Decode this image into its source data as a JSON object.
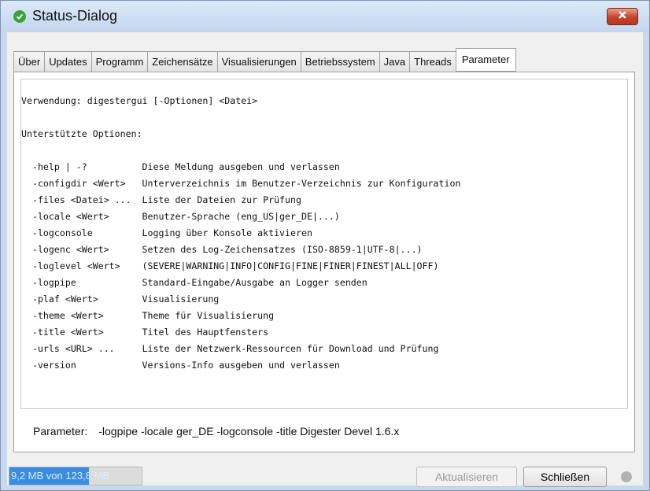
{
  "window": {
    "title": "Status-Dialog"
  },
  "tabs": [
    {
      "label": "Über"
    },
    {
      "label": "Updates"
    },
    {
      "label": "Programm"
    },
    {
      "label": "Zeichensätze"
    },
    {
      "label": "Visualisierungen"
    },
    {
      "label": "Betriebssystem"
    },
    {
      "label": "Java"
    },
    {
      "label": "Threads"
    },
    {
      "label": "Parameter",
      "active": true
    }
  ],
  "content": {
    "lines": [
      "Verwendung: digestergui [-Optionen] <Datei>",
      "",
      "Unterstützte Optionen:",
      "",
      "  -help | -?          Diese Meldung ausgeben und verlassen",
      "  -configdir <Wert>   Unterverzeichnis im Benutzer-Verzeichnis zur Konfiguration",
      "  -files <Datei> ...  Liste der Dateien zur Prüfung",
      "  -locale <Wert>      Benutzer-Sprache (eng_US|ger_DE|...)",
      "  -logconsole         Logging über Konsole aktivieren",
      "  -logenc <Wert>      Setzen des Log-Zeichensatzes (ISO-8859-1|UTF-8|...)",
      "  -loglevel <Wert>    (SEVERE|WARNING|INFO|CONFIG|FINE|FINER|FINEST|ALL|OFF)",
      "  -logpipe            Standard-Eingabe/Ausgabe an Logger senden",
      "  -plaf <Wert>        Visualisierung",
      "  -theme <Wert>       Theme für Visualisierung",
      "  -title <Wert>       Titel des Hauptfensters",
      "  -urls <URL> ...     Liste der Netzwerk-Ressourcen für Download und Prüfung",
      "  -version            Versions-Info ausgeben und verlassen"
    ]
  },
  "parameter": {
    "label": "Parameter:",
    "value": "-logpipe -locale ger_DE -logconsole -title Digester Devel 1.6.x"
  },
  "memory": {
    "text": "9,2 MB von 123,8 MB",
    "fraction": 0.6
  },
  "buttons": {
    "refresh": "Aktualisieren",
    "close": "Schließen"
  },
  "colors": {
    "accent": "#3a8ce0",
    "close": "#c6412a",
    "status_dot": "#b3b3b3"
  },
  "icons": {
    "title": "check-circle-icon",
    "close": "close-icon"
  }
}
